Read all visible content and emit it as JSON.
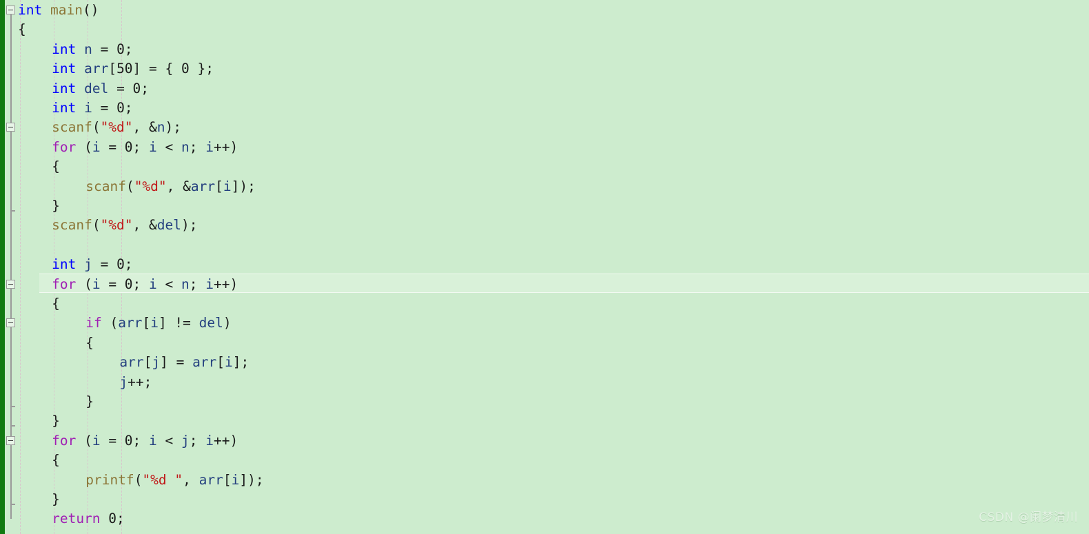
{
  "editor": {
    "language": "c",
    "background_color": "#cdecce",
    "current_line_color": "#d9f1d9",
    "change_bar_color": "#117a11",
    "current_line_number": 15,
    "colors": {
      "keyword": "#0000ff",
      "control_keyword": "#a020b4",
      "function": "#8b7536",
      "variable": "#24407f",
      "string": "#c01818",
      "plain": "#1b1b1b",
      "indent_guide": "#d8c6cc",
      "fold_marker": "#9a9a9a"
    }
  },
  "watermark": {
    "text": "CSDN @阑梦清川"
  },
  "fold_markers": [
    {
      "line": 1,
      "name": "fold-marker-main"
    },
    {
      "line": 7,
      "name": "fold-marker-for-read"
    },
    {
      "line": 15,
      "name": "fold-marker-for-filter"
    },
    {
      "line": 17,
      "name": "fold-marker-if-compare"
    },
    {
      "line": 23,
      "name": "fold-marker-for-print"
    }
  ],
  "code_lines": [
    {
      "n": 1,
      "indent": 0,
      "text": "int main()",
      "tokens": [
        {
          "t": "int",
          "c": "kw"
        },
        {
          "t": " ",
          "c": "punct"
        },
        {
          "t": "main",
          "c": "fn"
        },
        {
          "t": "()",
          "c": "punct"
        }
      ]
    },
    {
      "n": 2,
      "indent": 0,
      "text": "{",
      "tokens": [
        {
          "t": "{",
          "c": "punct"
        }
      ]
    },
    {
      "n": 3,
      "indent": 1,
      "text": "int n = 0;",
      "tokens": [
        {
          "t": "int",
          "c": "kw"
        },
        {
          "t": " ",
          "c": "punct"
        },
        {
          "t": "n",
          "c": "var"
        },
        {
          "t": " = 0;",
          "c": "punct"
        }
      ]
    },
    {
      "n": 4,
      "indent": 1,
      "text": "int arr[50] = { 0 };",
      "tokens": [
        {
          "t": "int",
          "c": "kw"
        },
        {
          "t": " ",
          "c": "punct"
        },
        {
          "t": "arr",
          "c": "var"
        },
        {
          "t": "[50] = { 0 };",
          "c": "punct"
        }
      ]
    },
    {
      "n": 5,
      "indent": 1,
      "text": "int del = 0;",
      "tokens": [
        {
          "t": "int",
          "c": "kw"
        },
        {
          "t": " ",
          "c": "punct"
        },
        {
          "t": "del",
          "c": "var"
        },
        {
          "t": " = 0;",
          "c": "punct"
        }
      ]
    },
    {
      "n": 6,
      "indent": 1,
      "text": "int i = 0;",
      "tokens": [
        {
          "t": "int",
          "c": "kw"
        },
        {
          "t": " ",
          "c": "punct"
        },
        {
          "t": "i",
          "c": "var"
        },
        {
          "t": " = 0;",
          "c": "punct"
        }
      ]
    },
    {
      "n": 7,
      "indent": 1,
      "text": "scanf(\"%d\", &n);",
      "tokens": [
        {
          "t": "scanf",
          "c": "fn"
        },
        {
          "t": "(",
          "c": "punct"
        },
        {
          "t": "\"%d\"",
          "c": "str"
        },
        {
          "t": ", &",
          "c": "punct"
        },
        {
          "t": "n",
          "c": "var"
        },
        {
          "t": ");",
          "c": "punct"
        }
      ]
    },
    {
      "n": 8,
      "indent": 1,
      "text": "for (i = 0; i < n; i++)",
      "tokens": [
        {
          "t": "for",
          "c": "ctl"
        },
        {
          "t": " (",
          "c": "punct"
        },
        {
          "t": "i",
          "c": "var"
        },
        {
          "t": " = 0; ",
          "c": "punct"
        },
        {
          "t": "i",
          "c": "var"
        },
        {
          "t": " < ",
          "c": "punct"
        },
        {
          "t": "n",
          "c": "var"
        },
        {
          "t": "; ",
          "c": "punct"
        },
        {
          "t": "i",
          "c": "var"
        },
        {
          "t": "++)",
          "c": "punct"
        }
      ]
    },
    {
      "n": 9,
      "indent": 1,
      "text": "{",
      "tokens": [
        {
          "t": "{",
          "c": "punct"
        }
      ]
    },
    {
      "n": 10,
      "indent": 2,
      "text": "scanf(\"%d\", &arr[i]);",
      "tokens": [
        {
          "t": "scanf",
          "c": "fn"
        },
        {
          "t": "(",
          "c": "punct"
        },
        {
          "t": "\"%d\"",
          "c": "str"
        },
        {
          "t": ", &",
          "c": "punct"
        },
        {
          "t": "arr",
          "c": "var"
        },
        {
          "t": "[",
          "c": "punct"
        },
        {
          "t": "i",
          "c": "var"
        },
        {
          "t": "]);",
          "c": "punct"
        }
      ]
    },
    {
      "n": 11,
      "indent": 1,
      "text": "}",
      "tokens": [
        {
          "t": "}",
          "c": "punct"
        }
      ]
    },
    {
      "n": 12,
      "indent": 1,
      "text": "scanf(\"%d\", &del);",
      "tokens": [
        {
          "t": "scanf",
          "c": "fn"
        },
        {
          "t": "(",
          "c": "punct"
        },
        {
          "t": "\"%d\"",
          "c": "str"
        },
        {
          "t": ", &",
          "c": "punct"
        },
        {
          "t": "del",
          "c": "var"
        },
        {
          "t": ");",
          "c": "punct"
        }
      ]
    },
    {
      "n": 13,
      "indent": 0,
      "text": "",
      "tokens": []
    },
    {
      "n": 14,
      "indent": 1,
      "text": "int j = 0;",
      "tokens": [
        {
          "t": "int",
          "c": "kw"
        },
        {
          "t": " ",
          "c": "punct"
        },
        {
          "t": "j",
          "c": "var"
        },
        {
          "t": " = 0;",
          "c": "punct"
        }
      ]
    },
    {
      "n": 15,
      "indent": 1,
      "text": "for (i = 0; i < n; i++)",
      "tokens": [
        {
          "t": "for",
          "c": "ctl"
        },
        {
          "t": " (",
          "c": "punct"
        },
        {
          "t": "i",
          "c": "var"
        },
        {
          "t": " = 0; ",
          "c": "punct"
        },
        {
          "t": "i",
          "c": "var"
        },
        {
          "t": " < ",
          "c": "punct"
        },
        {
          "t": "n",
          "c": "var"
        },
        {
          "t": "; ",
          "c": "punct"
        },
        {
          "t": "i",
          "c": "var"
        },
        {
          "t": "++)",
          "c": "punct"
        }
      ]
    },
    {
      "n": 16,
      "indent": 1,
      "text": "{",
      "tokens": [
        {
          "t": "{",
          "c": "punct"
        }
      ]
    },
    {
      "n": 17,
      "indent": 2,
      "text": "if (arr[i] != del)",
      "tokens": [
        {
          "t": "if",
          "c": "ctl"
        },
        {
          "t": " (",
          "c": "punct"
        },
        {
          "t": "arr",
          "c": "var"
        },
        {
          "t": "[",
          "c": "punct"
        },
        {
          "t": "i",
          "c": "var"
        },
        {
          "t": "] != ",
          "c": "punct"
        },
        {
          "t": "del",
          "c": "var"
        },
        {
          "t": ")",
          "c": "punct"
        }
      ]
    },
    {
      "n": 18,
      "indent": 2,
      "text": "{",
      "tokens": [
        {
          "t": "{",
          "c": "punct"
        }
      ]
    },
    {
      "n": 19,
      "indent": 3,
      "text": "arr[j] = arr[i];",
      "tokens": [
        {
          "t": "arr",
          "c": "var"
        },
        {
          "t": "[",
          "c": "punct"
        },
        {
          "t": "j",
          "c": "var"
        },
        {
          "t": "] = ",
          "c": "punct"
        },
        {
          "t": "arr",
          "c": "var"
        },
        {
          "t": "[",
          "c": "punct"
        },
        {
          "t": "i",
          "c": "var"
        },
        {
          "t": "];",
          "c": "punct"
        }
      ]
    },
    {
      "n": 20,
      "indent": 3,
      "text": "j++;",
      "tokens": [
        {
          "t": "j",
          "c": "var"
        },
        {
          "t": "++;",
          "c": "punct"
        }
      ]
    },
    {
      "n": 21,
      "indent": 2,
      "text": "}",
      "tokens": [
        {
          "t": "}",
          "c": "punct"
        }
      ]
    },
    {
      "n": 22,
      "indent": 1,
      "text": "}",
      "tokens": [
        {
          "t": "}",
          "c": "punct"
        }
      ]
    },
    {
      "n": 23,
      "indent": 1,
      "text": "for (i = 0; i < j; i++)",
      "tokens": [
        {
          "t": "for",
          "c": "ctl"
        },
        {
          "t": " (",
          "c": "punct"
        },
        {
          "t": "i",
          "c": "var"
        },
        {
          "t": " = 0; ",
          "c": "punct"
        },
        {
          "t": "i",
          "c": "var"
        },
        {
          "t": " < ",
          "c": "punct"
        },
        {
          "t": "j",
          "c": "var"
        },
        {
          "t": "; ",
          "c": "punct"
        },
        {
          "t": "i",
          "c": "var"
        },
        {
          "t": "++)",
          "c": "punct"
        }
      ]
    },
    {
      "n": 24,
      "indent": 1,
      "text": "{",
      "tokens": [
        {
          "t": "{",
          "c": "punct"
        }
      ]
    },
    {
      "n": 25,
      "indent": 2,
      "text": "printf(\"%d \", arr[i]);",
      "tokens": [
        {
          "t": "printf",
          "c": "fn"
        },
        {
          "t": "(",
          "c": "punct"
        },
        {
          "t": "\"%d \"",
          "c": "str"
        },
        {
          "t": ", ",
          "c": "punct"
        },
        {
          "t": "arr",
          "c": "var"
        },
        {
          "t": "[",
          "c": "punct"
        },
        {
          "t": "i",
          "c": "var"
        },
        {
          "t": "]);",
          "c": "punct"
        }
      ]
    },
    {
      "n": 26,
      "indent": 1,
      "text": "}",
      "tokens": [
        {
          "t": "}",
          "c": "punct"
        }
      ]
    },
    {
      "n": 27,
      "indent": 1,
      "text": "return 0;",
      "tokens": [
        {
          "t": "return",
          "c": "ctl"
        },
        {
          "t": " 0;",
          "c": "punct"
        }
      ]
    }
  ]
}
